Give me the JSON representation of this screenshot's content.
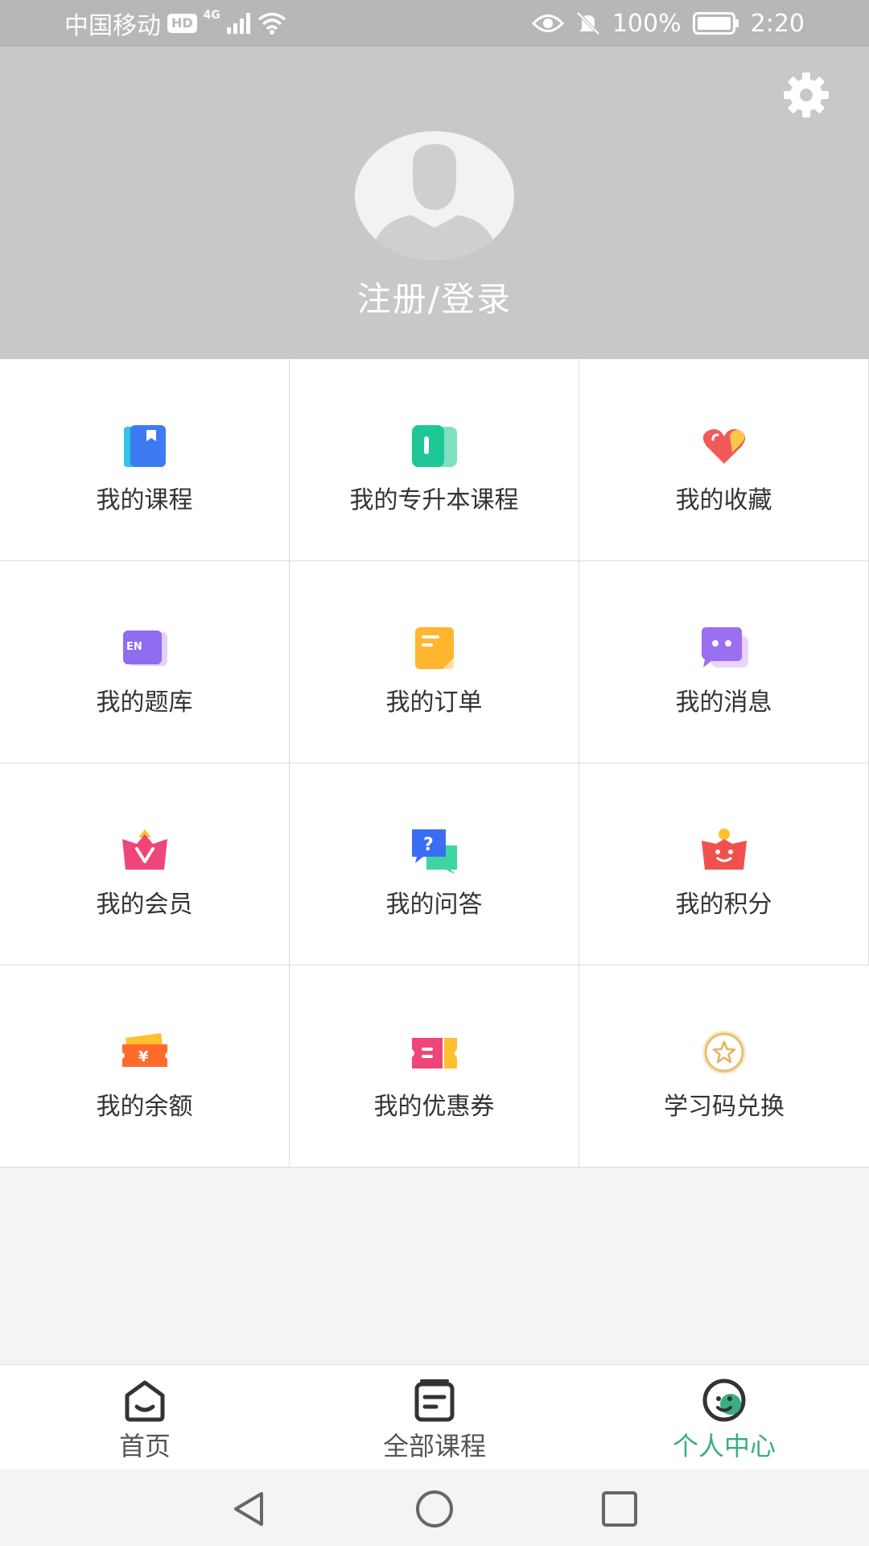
{
  "status_bar": {
    "carrier": "中国移动",
    "hd_badge": "HD",
    "network": "4G",
    "battery": "100%",
    "time": "2:20"
  },
  "header": {
    "login_label": "注册/登录"
  },
  "menu": {
    "items": [
      {
        "label": "我的课程",
        "icon": "book-icon"
      },
      {
        "label": "我的专升本课程",
        "icon": "open-book-icon"
      },
      {
        "label": "我的收藏",
        "icon": "heart-icon"
      },
      {
        "label": "我的题库",
        "icon": "question-bank-icon"
      },
      {
        "label": "我的订单",
        "icon": "order-note-icon"
      },
      {
        "label": "我的消息",
        "icon": "message-icon"
      },
      {
        "label": "我的会员",
        "icon": "vip-crown-icon"
      },
      {
        "label": "我的问答",
        "icon": "qa-chat-icon"
      },
      {
        "label": "我的积分",
        "icon": "points-basket-icon"
      },
      {
        "label": "我的余额",
        "icon": "balance-wallet-icon"
      },
      {
        "label": "我的优惠券",
        "icon": "coupon-ticket-icon"
      },
      {
        "label": "学习码兑换",
        "icon": "star-coin-icon"
      }
    ]
  },
  "bottom_nav": {
    "tabs": [
      {
        "label": "首页",
        "icon": "home-icon"
      },
      {
        "label": "全部课程",
        "icon": "courses-icon"
      },
      {
        "label": "个人中心",
        "icon": "profile-face-icon"
      }
    ],
    "active_color": "#3aae7f"
  },
  "colors": {
    "header_bg": "#c8c8c8",
    "status_bar_bg": "#b7b7b7"
  }
}
